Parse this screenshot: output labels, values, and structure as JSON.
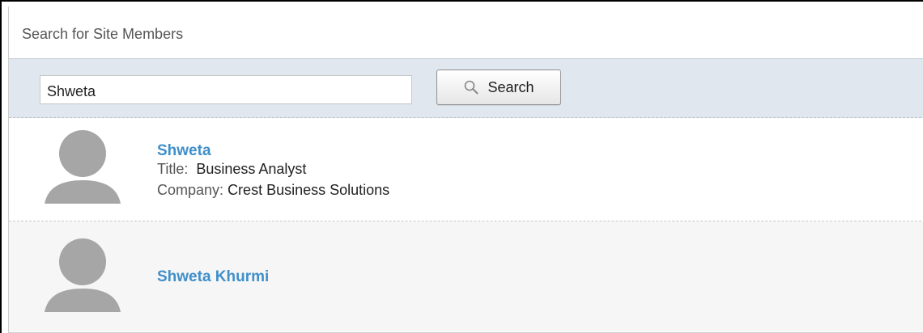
{
  "panel": {
    "title": "Search for Site Members"
  },
  "search": {
    "value": "Shweta",
    "button_label": "Search",
    "icon": "magnifier-icon"
  },
  "results": [
    {
      "name": "Shweta",
      "title_label": "Title:",
      "title_value": "Business Analyst",
      "company_label": "Company:",
      "company_value": "Crest Business Solutions",
      "avatar": "default-person-avatar"
    },
    {
      "name": "Shweta Khurmi",
      "avatar": "default-person-avatar"
    }
  ],
  "colors": {
    "link": "#3f8fc9",
    "search_bar_bg": "#e0e7ee",
    "avatar": "#a6a6a6"
  }
}
